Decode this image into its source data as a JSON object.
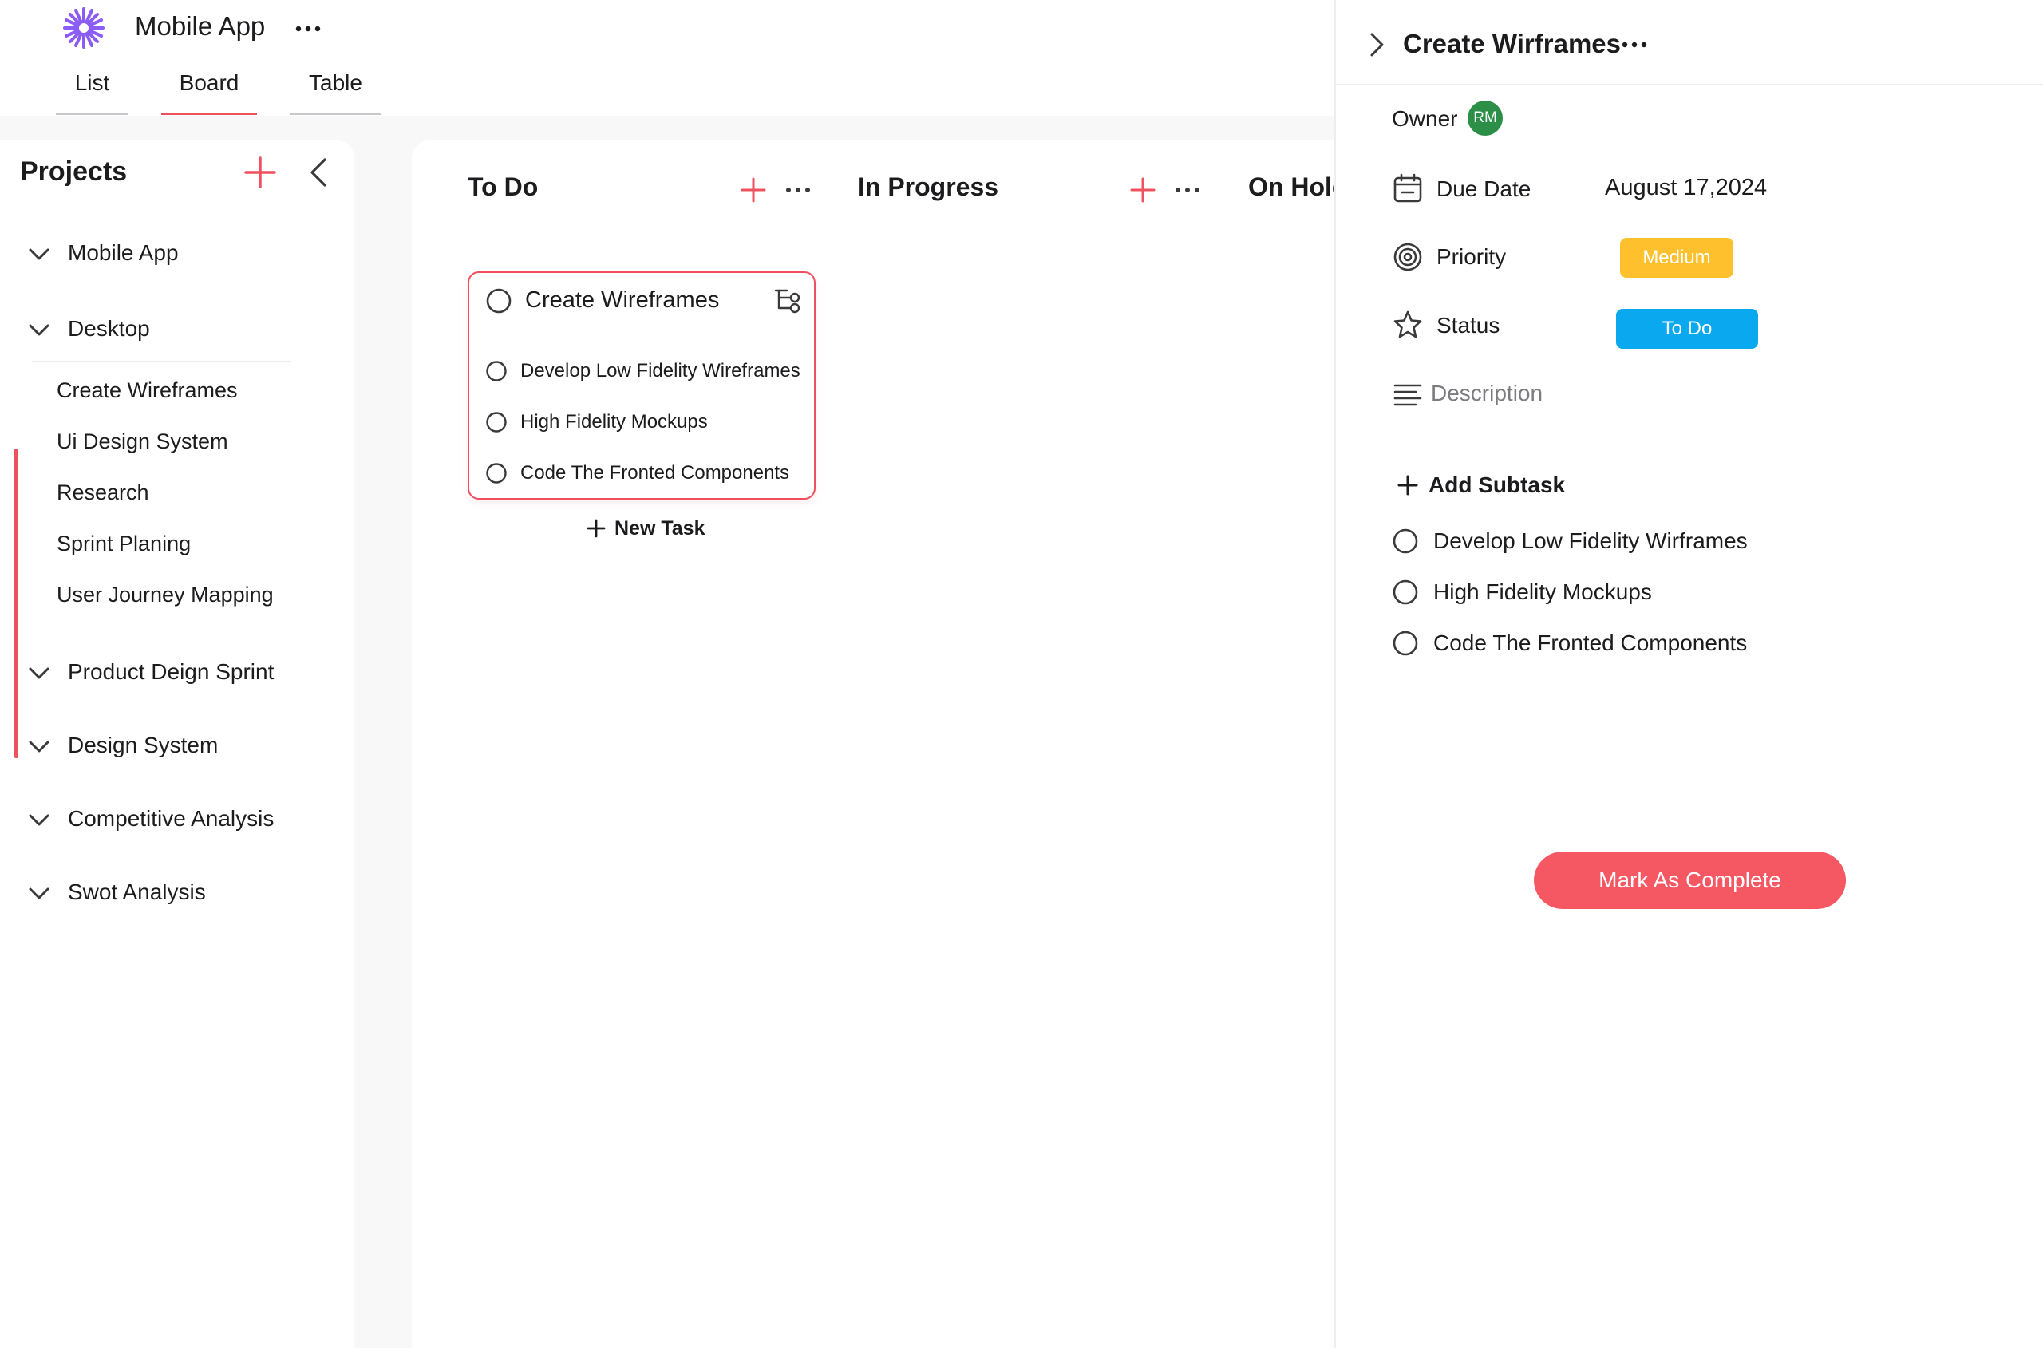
{
  "header": {
    "app_title": "Mobile App",
    "logo_icon": "asterisk-flower-icon",
    "tabs": [
      {
        "label": "List",
        "active": false
      },
      {
        "label": "Board",
        "active": true
      },
      {
        "label": "Table",
        "active": false
      }
    ]
  },
  "sidebar": {
    "title": "Projects",
    "groups": [
      {
        "label": "Mobile App"
      },
      {
        "label": "Desktop",
        "expanded": true,
        "items": [
          "Create Wireframes",
          "Ui Design System",
          "Research",
          "Sprint Planing",
          "User Journey Mapping"
        ]
      },
      {
        "label": "Product Deign Sprint"
      },
      {
        "label": "Design System"
      },
      {
        "label": "Competitive Analysis"
      },
      {
        "label": "Swot Analysis"
      }
    ]
  },
  "board": {
    "columns": [
      {
        "title": "To Do"
      },
      {
        "title": "In Progress"
      },
      {
        "title": "On Hold"
      }
    ],
    "card": {
      "title": "Create Wireframes",
      "subtasks": [
        "Develop Low Fidelity Wireframes",
        "High Fidelity Mockups",
        "Code The Fronted Components"
      ]
    },
    "new_task_label": "New Task"
  },
  "detail": {
    "title": "Create Wirframes",
    "owner_label": "Owner",
    "owner_initials": "RM",
    "due_date_label": "Due Date",
    "due_date_value": "August 17,2024",
    "priority_label": "Priority",
    "priority_value": "Medium",
    "status_label": "Status",
    "status_value": "To Do",
    "description_placeholder": "Description",
    "add_subtask_label": "Add Subtask",
    "subtasks": [
      "Develop Low Fidelity Wirframes",
      "High Fidelity Mockups",
      "Code The Fronted Components"
    ],
    "complete_button": "Mark As Complete"
  },
  "colors": {
    "accent": "#f0515f",
    "priority_medium": "#fec02c",
    "status_todo": "#0aa8ef",
    "avatar": "#2c8f48",
    "logo": "#8b5cf6"
  }
}
